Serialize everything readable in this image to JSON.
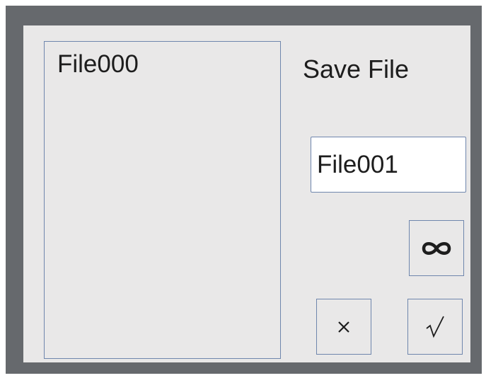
{
  "dialog": {
    "title": "Save File"
  },
  "file_list": {
    "items": [
      {
        "label": "File000"
      }
    ]
  },
  "filename_input": {
    "value": "File001"
  },
  "buttons": {
    "keyboard": {
      "icon": "infinity-icon"
    },
    "cancel": {
      "icon": "close-icon"
    },
    "confirm": {
      "icon": "checkmark-icon"
    }
  },
  "colors": {
    "frame": "#66696d",
    "dialog_background": "#e9e8e8",
    "border": "#6f86ad",
    "text": "#1d1d1d"
  }
}
